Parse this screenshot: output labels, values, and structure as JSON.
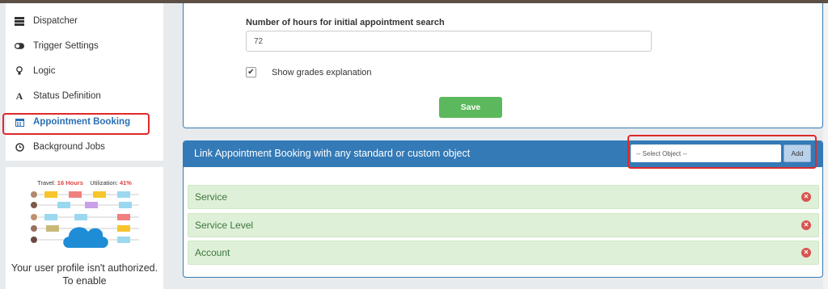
{
  "sidebar": {
    "items": [
      {
        "label": "Dispatcher",
        "icon": "list-icon"
      },
      {
        "label": "Trigger Settings",
        "icon": "toggle-icon"
      },
      {
        "label": "Logic",
        "icon": "lightbulb-icon"
      },
      {
        "label": "Status Definition",
        "icon": "font-icon"
      },
      {
        "label": "Appointment Booking",
        "icon": "calendar-icon",
        "active": true
      },
      {
        "label": "Background Jobs",
        "icon": "clock-icon"
      }
    ]
  },
  "promo": {
    "travel_label": "Travel:",
    "travel_value": "16 Hours",
    "utilization_label": "Utilization:",
    "utilization_value": "41%",
    "message": "Your user profile isn't authorized. To enable"
  },
  "settings": {
    "hours_label": "Number of hours for initial appointment search",
    "hours_value": "72",
    "grades_checked": true,
    "grades_label": "Show grades explanation",
    "save_label": "Save"
  },
  "link_panel": {
    "title": "Link Appointment Booking with any standard or custom object",
    "select_placeholder": "-- Select Object --",
    "add_label": "Add",
    "objects": [
      "Service",
      "Service Level",
      "Account"
    ]
  },
  "colors": {
    "accent": "#337ab7",
    "success": "#5cb85c",
    "danger": "#d9534f",
    "highlight": "#e02828"
  }
}
